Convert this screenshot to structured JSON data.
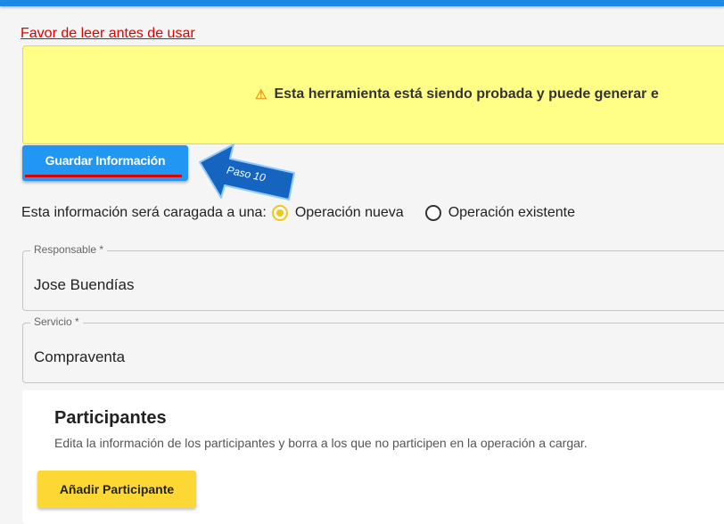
{
  "header": {
    "read_first_link": "Favor de leer antes de usar"
  },
  "warning": {
    "icon": "warning-icon",
    "text": "Esta herramienta está siendo probada y puede generar e"
  },
  "toolbar": {
    "save_label": "Guardar Información"
  },
  "callout": {
    "label": "Paso 10"
  },
  "operation": {
    "prompt": "Esta información será caragada a una:",
    "options": [
      {
        "label": "Operación nueva",
        "selected": true
      },
      {
        "label": "Operación existente",
        "selected": false
      }
    ]
  },
  "fields": {
    "responsable": {
      "label": "Responsable *",
      "value": "Jose Buendías"
    },
    "servicio": {
      "label": "Servicio *",
      "value": "Compraventa"
    }
  },
  "participants": {
    "title": "Participantes",
    "description": "Edita la información de los participantes y borra a los que no participen en la operación a cargar.",
    "add_label": "Añadir Participante"
  },
  "colors": {
    "accent_blue": "#2196f3",
    "warning_bg": "#ffff88",
    "radio_yellow": "#f5c518",
    "add_button": "#fdd835",
    "alert_red": "#e00000"
  }
}
